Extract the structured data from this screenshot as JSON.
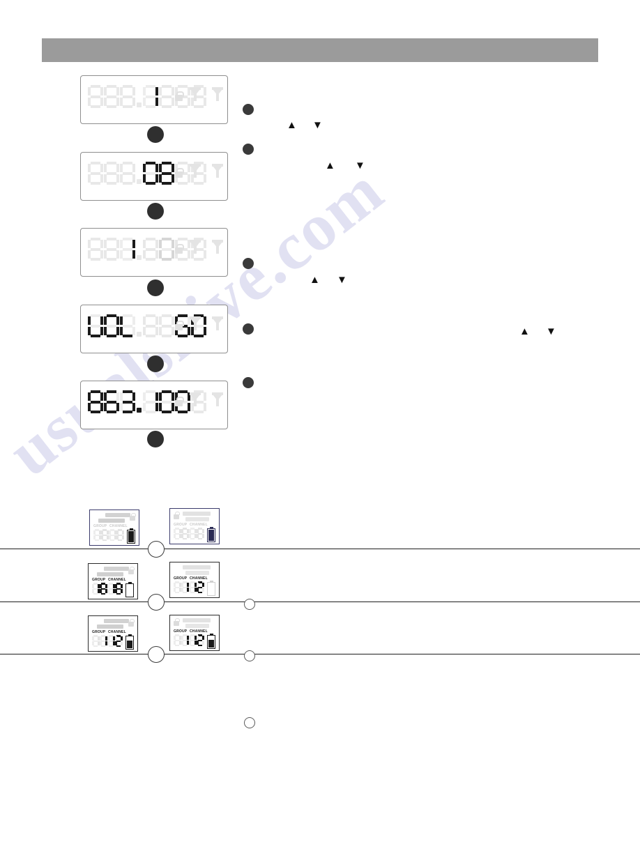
{
  "header": {
    "title": ""
  },
  "watermark": {
    "text": "usualshive.com"
  },
  "displays": [
    {
      "id": "display-frequency-blank",
      "digits": [
        {
          "char": "8",
          "state": "off"
        },
        {
          "char": "8",
          "state": "off"
        },
        {
          "char": "8",
          "state": "off"
        },
        {
          "char": "1",
          "state": "on"
        },
        {
          "char": "8",
          "state": "off"
        },
        {
          "char": "8",
          "state": "off"
        },
        {
          "char": "8",
          "state": "off"
        }
      ],
      "decimal_after": 3,
      "decimal_on": false,
      "lock_icon": "lock-icon",
      "antenna_icons": [
        "antenna-a-icon",
        "antenna-b-icon"
      ],
      "value_text": "1"
    },
    {
      "id": "display-channel-08",
      "digits": [
        {
          "char": "8",
          "state": "off"
        },
        {
          "char": "8",
          "state": "off"
        },
        {
          "char": "8",
          "state": "off"
        },
        {
          "char": "0",
          "state": "on"
        },
        {
          "char": "8",
          "state": "on"
        },
        {
          "char": "8",
          "state": "off"
        },
        {
          "char": "8",
          "state": "off"
        }
      ],
      "decimal_after": 3,
      "decimal_on": false,
      "lock_icon": "lock-icon",
      "antenna_icons": [
        "antenna-a-icon",
        "antenna-b-icon"
      ],
      "value_text": "08"
    },
    {
      "id": "display-group-1-0",
      "digits": [
        {
          "char": "8",
          "state": "off"
        },
        {
          "char": "8",
          "state": "off"
        },
        {
          "char": "1",
          "state": "on"
        },
        {
          "char": "8",
          "state": "off"
        },
        {
          "char": "0",
          "state": "mid"
        },
        {
          "char": "8",
          "state": "off"
        },
        {
          "char": "8",
          "state": "off"
        }
      ],
      "decimal_after": 3,
      "decimal_on": false,
      "lock_icon": "lock-icon",
      "antenna_icons": [
        "antenna-a-icon",
        "antenna-b-icon"
      ],
      "value_text": "1 0"
    },
    {
      "id": "display-volume-60",
      "digits": [
        {
          "char": "U",
          "state": "on"
        },
        {
          "char": "O",
          "state": "on"
        },
        {
          "char": "L",
          "state": "on"
        },
        {
          "char": "8",
          "state": "off"
        },
        {
          "char": "8",
          "state": "off"
        },
        {
          "char": "6",
          "state": "on"
        },
        {
          "char": "0",
          "state": "on"
        }
      ],
      "decimal_after": 3,
      "decimal_on": false,
      "lock_icon": "lock-icon",
      "antenna_icons": [
        "antenna-a-icon",
        "antenna-b-icon"
      ],
      "value_text": "VOL 60"
    },
    {
      "id": "display-frequency-863100",
      "digits": [
        {
          "char": "8",
          "state": "on"
        },
        {
          "char": "6",
          "state": "on"
        },
        {
          "char": "3",
          "state": "on"
        },
        {
          "char": "1",
          "state": "on"
        },
        {
          "char": "0",
          "state": "on"
        },
        {
          "char": "0",
          "state": "on"
        },
        {
          "char": "8",
          "state": "off"
        }
      ],
      "decimal_after": 3,
      "decimal_on": true,
      "lock_icon": "lock-icon",
      "antenna_icons": [
        "antenna-a-icon",
        "antenna-b-icon"
      ],
      "value_text": "863.100"
    }
  ],
  "step_arrows": [
    {
      "id": "arrows-step-1",
      "up": "▲",
      "down": "▼"
    },
    {
      "id": "arrows-step-2",
      "up": "▲",
      "down": "▼"
    },
    {
      "id": "arrows-step-3",
      "up": "▲",
      "down": "▼"
    },
    {
      "id": "arrows-step-4",
      "up": "▲",
      "down": "▼"
    }
  ],
  "mini_labels": {
    "group": "GROUP",
    "channel": "CHANNEL"
  },
  "mini_displays": [
    {
      "id": "mini-row1-left",
      "style": "dim",
      "group": [
        {
          "char": "1",
          "state": "off"
        },
        {
          "char": "8",
          "state": "off"
        }
      ],
      "channel": [
        {
          "char": "1",
          "state": "off"
        },
        {
          "char": "8",
          "state": "off"
        }
      ],
      "group_text": "18",
      "channel_text": "18",
      "battery_level": "lvl3",
      "battery_tone": "dark",
      "lock": "dim",
      "lock_side": "right"
    },
    {
      "id": "mini-row1-right",
      "style": "dim",
      "group": [
        {
          "char": "1",
          "state": "off"
        },
        {
          "char": "8",
          "state": "off"
        }
      ],
      "channel": [
        {
          "char": "1",
          "state": "off"
        },
        {
          "char": "8",
          "state": "off"
        }
      ],
      "group_text": "18",
      "channel_text": "18",
      "battery_level": "lvl3",
      "battery_tone": "blue",
      "lock": "dim",
      "lock_side": "left"
    },
    {
      "id": "mini-row2-left",
      "style": "lit",
      "group": [
        {
          "char": "1",
          "state": "on"
        },
        {
          "char": "8",
          "state": "on"
        }
      ],
      "channel": [
        {
          "char": "1",
          "state": "on"
        },
        {
          "char": "8",
          "state": "on"
        }
      ],
      "group_text": "18",
      "channel_text": "18",
      "battery_level": "lvl0",
      "battery_tone": "dark",
      "lock": "dim",
      "lock_side": "right"
    },
    {
      "id": "mini-row2-right",
      "style": "lit",
      "group": [
        {
          "char": "1",
          "state": "off"
        },
        {
          "char": "1",
          "state": "on"
        }
      ],
      "channel": [
        {
          "char": "1",
          "state": "on"
        },
        {
          "char": "2",
          "state": "on"
        }
      ],
      "group_text": "1",
      "channel_text": "12",
      "battery_level": "lvl0",
      "battery_tone": "dim",
      "lock": "none",
      "lock_side": "left"
    },
    {
      "id": "mini-row3-left",
      "style": "lit",
      "group": [
        {
          "char": "1",
          "state": "off"
        },
        {
          "char": "1",
          "state": "on"
        }
      ],
      "channel": [
        {
          "char": "1",
          "state": "on"
        },
        {
          "char": "2",
          "state": "on"
        }
      ],
      "group_text": "1",
      "channel_text": "12",
      "battery_level": "lvl2",
      "battery_tone": "dark",
      "lock": "dim",
      "lock_side": "right"
    },
    {
      "id": "mini-row3-right",
      "style": "lit",
      "group": [
        {
          "char": "1",
          "state": "off"
        },
        {
          "char": "1",
          "state": "on"
        }
      ],
      "channel": [
        {
          "char": "1",
          "state": "on"
        },
        {
          "char": "2",
          "state": "on"
        }
      ],
      "group_text": "1",
      "channel_text": "12",
      "battery_level": "lvl2",
      "battery_tone": "dark",
      "lock": "dim",
      "lock_side": "left"
    }
  ],
  "connectors": [
    {
      "id": "connector-1-2"
    },
    {
      "id": "connector-2-3"
    },
    {
      "id": "connector-3-4"
    },
    {
      "id": "connector-4-5"
    },
    {
      "id": "connector-5-end"
    }
  ],
  "rule_circles": [
    {
      "id": "rule-circle-1"
    },
    {
      "id": "rule-circle-2"
    },
    {
      "id": "rule-circle-3"
    }
  ],
  "hollow_bullets": [
    {
      "id": "hollow-bullet-1"
    },
    {
      "id": "hollow-bullet-2"
    },
    {
      "id": "hollow-bullet-3"
    }
  ],
  "solid_bullets": [
    {
      "id": "solid-bullet-1"
    },
    {
      "id": "solid-bullet-2"
    },
    {
      "id": "solid-bullet-3"
    },
    {
      "id": "solid-bullet-4"
    },
    {
      "id": "solid-bullet-5"
    }
  ],
  "colors": {
    "header_band": "#9b9b9b",
    "segment_on": "#1b1b1b",
    "segment_off": "#e8e8e8",
    "watermark": "#dcdcf0"
  }
}
